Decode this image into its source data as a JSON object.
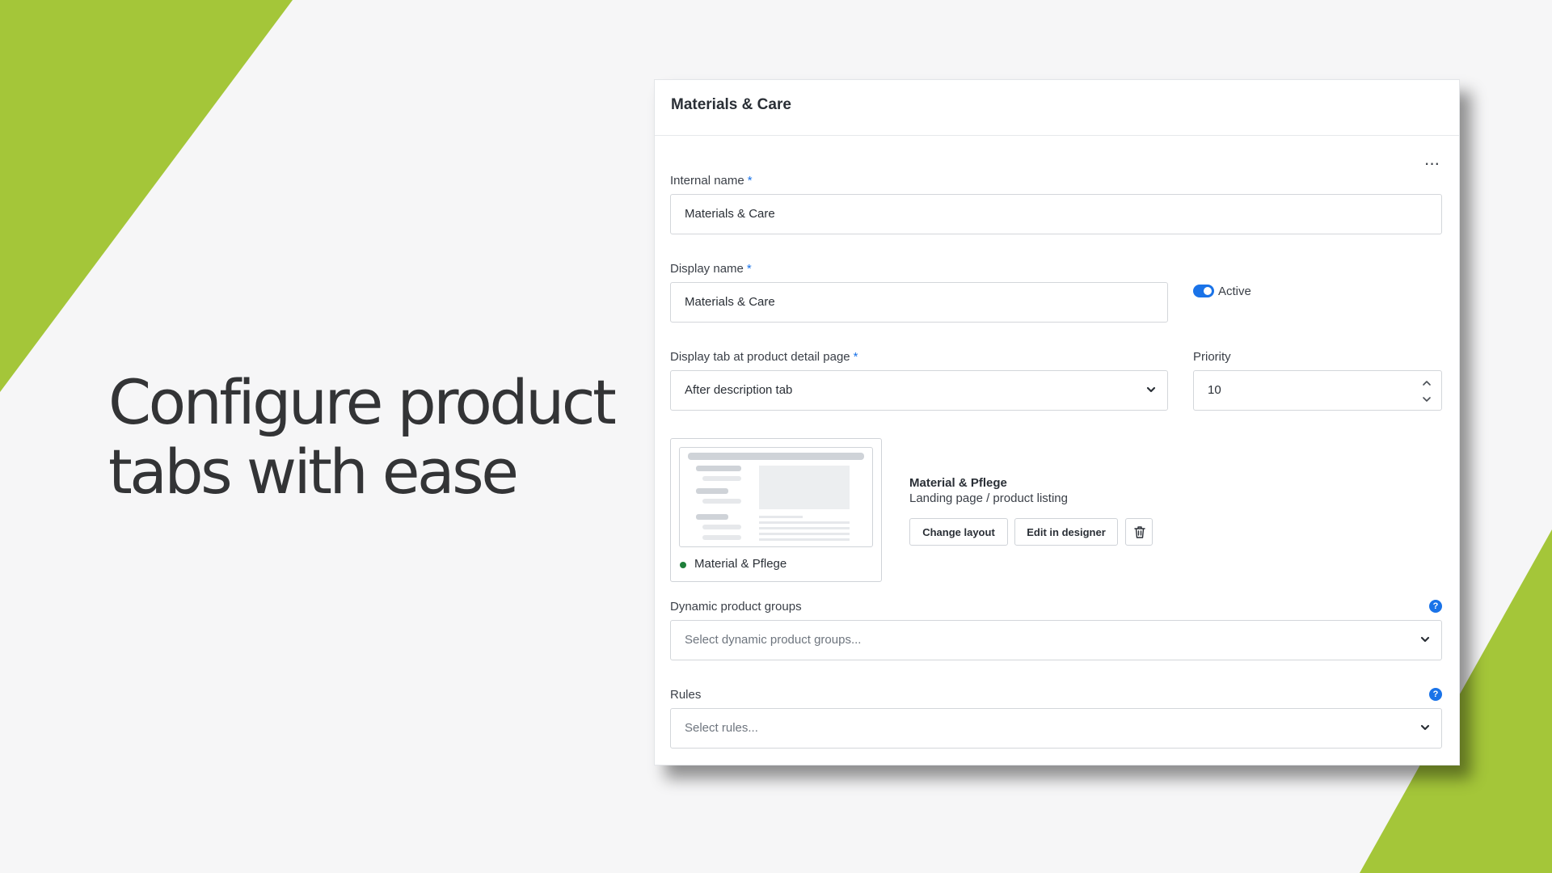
{
  "colors": {
    "accent_green": "#a4c639",
    "primary_blue": "#1a73e8",
    "status_green": "#1e7f3a"
  },
  "headline": "Configure product\ntabs with ease",
  "card": {
    "title": "Materials & Care",
    "more_icon": "more-horizontal-icon",
    "internal_name": {
      "label": "Internal name",
      "required": "*",
      "value": "Materials & Care"
    },
    "display_name": {
      "label": "Display name",
      "required": "*",
      "value": "Materials & Care"
    },
    "active": {
      "label": "Active",
      "on": true
    },
    "display_tab": {
      "label": "Display tab at product detail page",
      "required": "*",
      "value": "After description tab"
    },
    "priority": {
      "label": "Priority",
      "value": "10"
    },
    "layout": {
      "card_name": "Material & Pflege",
      "name": "Material & Pflege",
      "type": "Landing page / product listing",
      "change_layout": "Change layout",
      "edit_in_designer": "Edit in designer",
      "delete_icon": "trash-icon"
    },
    "dynamic_groups": {
      "label": "Dynamic product groups",
      "placeholder": "Select dynamic product groups...",
      "help": "?"
    },
    "rules": {
      "label": "Rules",
      "placeholder": "Select rules...",
      "help": "?"
    }
  }
}
